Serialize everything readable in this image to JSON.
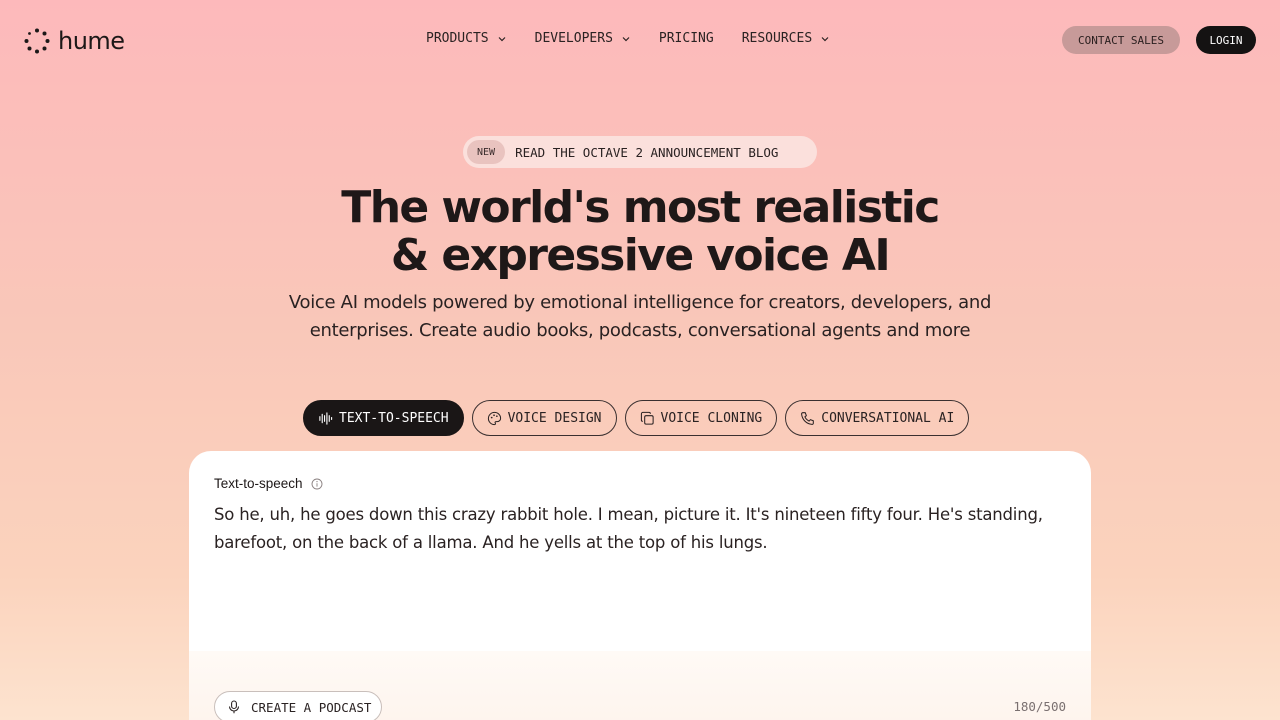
{
  "brand": {
    "name": "hume"
  },
  "nav": {
    "items": [
      {
        "label": "PRODUCTS",
        "has_dropdown": true
      },
      {
        "label": "DEVELOPERS",
        "has_dropdown": true
      },
      {
        "label": "PRICING",
        "has_dropdown": false
      },
      {
        "label": "RESOURCES",
        "has_dropdown": true
      }
    ],
    "contact_label": "CONTACT SALES",
    "login_label": "LOGIN"
  },
  "announcement": {
    "badge": "NEW",
    "text": "READ THE OCTAVE 2 ANNOUNCEMENT BLOG"
  },
  "hero": {
    "title_line1": "The world's most realistic",
    "title_line2": "& expressive voice AI",
    "subtitle": "Voice AI models powered by emotional intelligence for creators, developers, and enterprises. Create audio books, podcasts, conversational agents and more"
  },
  "tabs": [
    {
      "label": "TEXT-TO-SPEECH",
      "icon": "waveform-icon",
      "active": true
    },
    {
      "label": "VOICE DESIGN",
      "icon": "palette-icon",
      "active": false
    },
    {
      "label": "VOICE CLONING",
      "icon": "copy-icon",
      "active": false
    },
    {
      "label": "CONVERSATIONAL AI",
      "icon": "phone-icon",
      "active": false
    }
  ],
  "card": {
    "label": "Text-to-speech",
    "text": "So he, uh, he goes down this crazy rabbit hole. I mean, picture it. It's nineteen fifty four. He's standing, barefoot, on the back of a llama. And he yells at the top of his lungs.",
    "podcast_label": "CREATE A PODCAST",
    "char_count": "180/500"
  },
  "colors": {
    "accent_dark": "#1a1616",
    "contact_bg": "#c79a99",
    "background_top": "#fdb9bb",
    "background_bottom": "#fde3cf"
  }
}
